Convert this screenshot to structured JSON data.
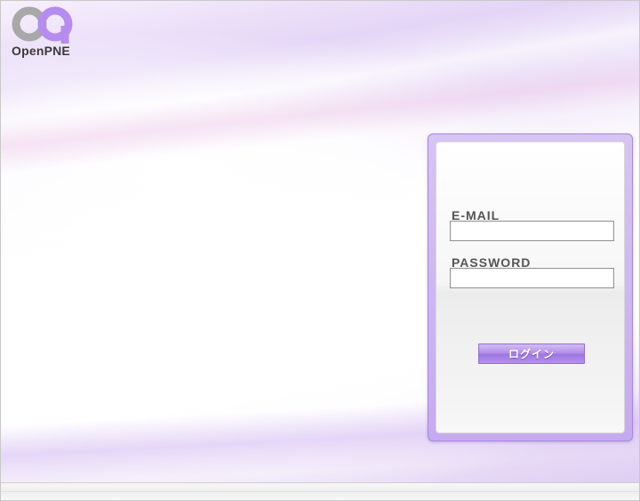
{
  "brand": {
    "name": "OpenPNE",
    "logo_icon": "openpne-logo-icon",
    "colors": {
      "logo_gray": "#a8a8a8",
      "logo_purple": "#b68cf0",
      "accent": "#b18be9"
    }
  },
  "login": {
    "email_label": "E-MAIL",
    "email_value": "",
    "password_label": "PASSWORD",
    "password_value": "",
    "submit_label": "ログイン"
  }
}
